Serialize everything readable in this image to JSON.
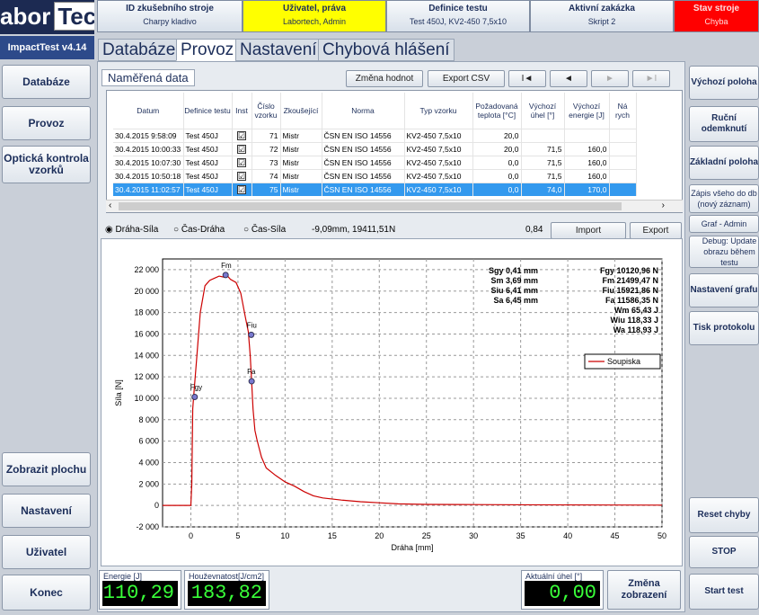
{
  "logo": {
    "part1": "abor",
    "part2": "Tech"
  },
  "version": "ImpactTest v4.14",
  "left_nav": [
    {
      "label": "Databáze"
    },
    {
      "label": "Provoz"
    },
    {
      "label": "Optická kontrola vzorků"
    },
    {
      "label": "Zobrazit plochu"
    },
    {
      "label": "Nastavení"
    },
    {
      "label": "Uživatel"
    },
    {
      "label": "Konec"
    }
  ],
  "header": [
    {
      "title": "ID zkušebního stroje",
      "value": "Charpy kladivo",
      "bg": "#e4eaf2"
    },
    {
      "title": "Uživatel, práva",
      "value": "Labortech, Admin",
      "bg": "#ffff00"
    },
    {
      "title": "Definice testu",
      "value": "Test 450J, KV2-450 7,5x10",
      "bg": "#e4eaf2"
    },
    {
      "title": "Aktivní zakázka",
      "value": "Skript 2",
      "bg": "#e4eaf2"
    },
    {
      "title": "Stav stroje",
      "value": "Chyba",
      "bg": "#ff0000"
    }
  ],
  "tabs": [
    "Databáze",
    "Provoz",
    "Nastavení",
    "Chybová hlášení"
  ],
  "section_title": "Naměřená data",
  "toolbar": {
    "change_values": "Změna hodnot",
    "export_csv": "Export CSV",
    "first": "I◄",
    "prev": "◄",
    "next": "►",
    "last": "►I"
  },
  "table": {
    "columns": [
      "Datum",
      "Definice testu",
      "Inst",
      "Číslo vzorku",
      "Zkoušející",
      "Norma",
      "Typ vzorku",
      "Požadovaná teplota [°C]",
      "Výchozí úhel [°]",
      "Výchozí energie [J]",
      "Ná rych"
    ],
    "rows": [
      [
        "30.4.2015 9:58:09",
        "Test 450J",
        "☑",
        "71",
        "Mistr",
        "ČSN EN ISO 14556",
        "KV2-450 7,5x10",
        "20,0",
        "",
        ""
      ],
      [
        "30.4.2015 10:00:33",
        "Test 450J",
        "☑",
        "72",
        "Mistr",
        "ČSN EN ISO 14556",
        "KV2-450 7,5x10",
        "20,0",
        "71,5",
        "160,0"
      ],
      [
        "30.4.2015 10:07:30",
        "Test 450J",
        "☑",
        "73",
        "Mistr",
        "ČSN EN ISO 14556",
        "KV2-450 7,5x10",
        "0,0",
        "71,5",
        "160,0"
      ],
      [
        "30.4.2015 10:50:18",
        "Test 450J",
        "☑",
        "74",
        "Mistr",
        "ČSN EN ISO 14556",
        "KV2-450 7,5x10",
        "0,0",
        "71,5",
        "160,0"
      ],
      [
        "30.4.2015 11:02:57",
        "Test 450J",
        "☑",
        "75",
        "Mistr",
        "ČSN EN ISO 14556",
        "KV2-450 7,5x10",
        "0,0",
        "74,0",
        "170,0"
      ]
    ],
    "selected_row": 4
  },
  "graph_bar": {
    "radios": [
      "Dráha-Síla",
      "Čas-Dráha",
      "Čas-Síla"
    ],
    "selected": 0,
    "cursor": "-9,09mm, 19411,51N",
    "value": "0,84",
    "import": "Import",
    "export": "Export"
  },
  "chart_data": {
    "type": "line",
    "xlabel": "Dráha [mm]",
    "ylabel": "Síla [N]",
    "xlim": [
      -3,
      50
    ],
    "ylim": [
      -2000,
      23000
    ],
    "xticks": [
      "0",
      "5",
      "10",
      "15",
      "20",
      "25",
      "30",
      "35",
      "40",
      "45",
      "50"
    ],
    "yticks": [
      "-2 000",
      "0",
      "2 000",
      "4 000",
      "6 000",
      "8 000",
      "10 000",
      "12 000",
      "14 000",
      "16 000",
      "18 000",
      "20 000",
      "22 000"
    ],
    "series": [
      {
        "name": "Soupiska",
        "color": "#cc0000",
        "x": [
          -3,
          0,
          0.1,
          0.2,
          0.3,
          0.6,
          1,
          1.5,
          2,
          2.5,
          3,
          3.5,
          3.8,
          4.2,
          4.8,
          5.3,
          5.8,
          6.1,
          6.3,
          6.45,
          6.6,
          6.8,
          7,
          7.2,
          7.5,
          8,
          9,
          10,
          11,
          12,
          13,
          14,
          16,
          18,
          20,
          22,
          25,
          30,
          35,
          40,
          45,
          50
        ],
        "y": [
          0,
          0,
          2000,
          9000,
          10200,
          13500,
          18000,
          20500,
          21000,
          21200,
          21400,
          21300,
          21500,
          21100,
          20800,
          19800,
          17500,
          16200,
          14000,
          11600,
          9000,
          7000,
          6200,
          5500,
          4500,
          3500,
          2800,
          2200,
          1800,
          1300,
          900,
          700,
          500,
          350,
          250,
          150,
          100,
          80,
          60,
          50,
          40,
          30
        ]
      }
    ],
    "markers": [
      {
        "label": "Fgy",
        "x": 0.41,
        "y": 10120.96
      },
      {
        "label": "Fm",
        "x": 3.69,
        "y": 21499.47
      },
      {
        "label": "Fiu",
        "x": 6.41,
        "y": 15921.86
      },
      {
        "label": "Fa",
        "x": 6.45,
        "y": 11586.35
      }
    ],
    "annotations": [
      "Sgy 0,41 mm",
      "Sm 3,69 mm",
      "Siu 6,41 mm",
      "Sa 6,45 mm",
      "Fgy 10120,96 N",
      "Fm 21499,47 N",
      "Fiu 15921,86 N",
      "Fa 11586,35 N",
      "Wm 65,43 J",
      "Wiu 118,33 J",
      "Wa 118,93 J"
    ],
    "legend": "right",
    "grid": true
  },
  "right_nav": [
    {
      "label": "Výchozí poloha",
      "style": ""
    },
    {
      "label": "Ruční odemknutí",
      "style": ""
    },
    {
      "label": "Základní poloha",
      "style": ""
    },
    {
      "label": "Zápis všeho do db (nový záznam)",
      "style": "sm"
    },
    {
      "label": "Graf - Admin",
      "style": "sm"
    },
    {
      "label": "Debug: Update obrazu během testu",
      "style": "sm"
    },
    {
      "label": "Nastavení grafu",
      "style": ""
    },
    {
      "label": "Tisk protokolu",
      "style": ""
    },
    {
      "label": "Reset chyby",
      "style": ""
    },
    {
      "label": "STOP",
      "style": ""
    },
    {
      "label": "Start test",
      "style": ""
    }
  ],
  "meters": {
    "energy_label": "Energie [J]",
    "energy": "110,29",
    "toughness_label": "Houževnatost[J/cm2]",
    "toughness": "183,82",
    "angle_label": "Aktuální úhel [°]",
    "angle": "0,00",
    "change_display": "Změna zobrazení"
  }
}
